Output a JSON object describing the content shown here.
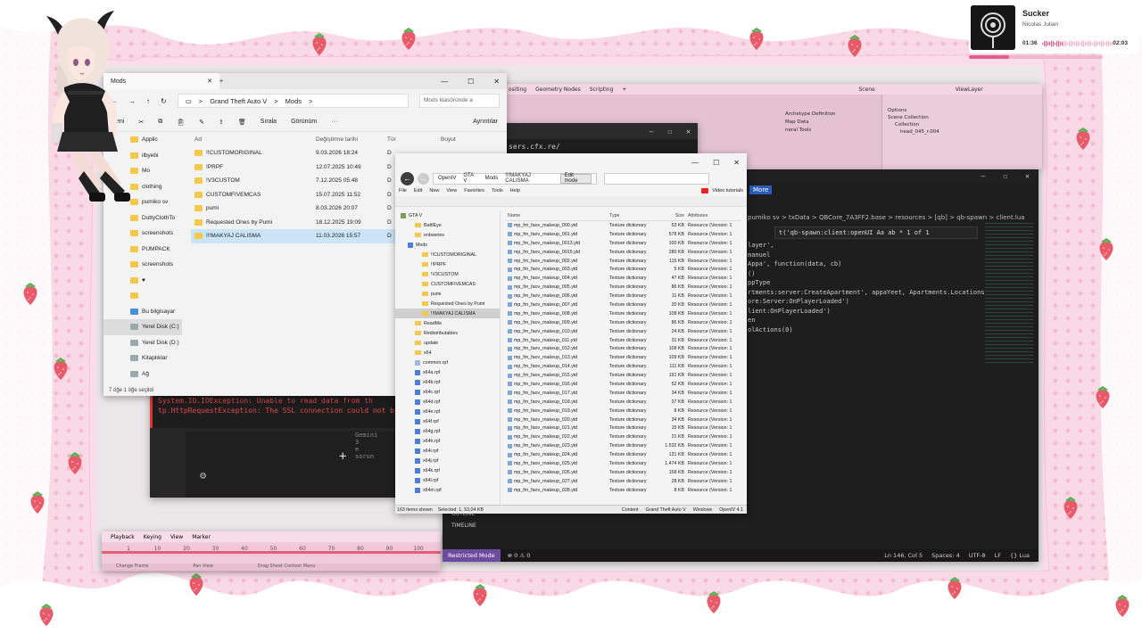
{
  "colors": {
    "pink_frame": "#f7c6d8",
    "strawberry": "#e85a6a",
    "selection": "#cce4f7",
    "vscode_bg": "#1e1e1e",
    "restricted": "#6b4ca1"
  },
  "music": {
    "title": "Sucker",
    "artist": "Nicolas Julian",
    "elapsed": "01:36",
    "duration": "02:03",
    "progress": 0.3
  },
  "blender": {
    "menu": [
      "ositing",
      "Geometry Nodes",
      "Scripting",
      "+"
    ],
    "scene": "Scene",
    "view_layer": "ViewLayer",
    "options": "Options",
    "scene_collection": "Scene Collection",
    "collection": "Collection",
    "object": "head_045_r.004",
    "rows": [
      "Archetype Definition",
      "Map Data",
      "neral Tools"
    ],
    "timeline_menu": [
      "Playback",
      "Keying",
      "View",
      "Marker"
    ],
    "timeline_ticks": [
      "1",
      "10",
      "20",
      "30",
      "40",
      "50",
      "60",
      "70",
      "80",
      "90",
      "100"
    ],
    "timeline_bottom": [
      "Change Frame",
      "Pan View",
      "Drag Sheet Context Menu"
    ]
  },
  "terminal": {
    "line": "sers.cfx.re/"
  },
  "dark_app": {
    "error1": "System.IO.IOException: Unable to read data from th",
    "error2": "tp.HttpRequestException: The SSL connection could not b",
    "prompt": "Gemini 3 e sorun"
  },
  "vscode": {
    "more": "More",
    "crumbs": "pumiko sv  >  txData  >  QBCore_7A3FF2.base  >  resources  >  [qb]  >  qb-spawn  >  client.lua",
    "find_text": "t('qb-spawn:client:openUI Aa  ab  *   1 of 1",
    "code": [
      "layer',",
      "manuel",
      "",
      "",
      "Appa', function(data, cb)",
      "()",
      "ppType",
      "",
      "",
      "",
      "rtments:server:CreateApartment', appaYeet, Apartments.Locations",
      "ore:Server:OnPlayerLoaded')",
      "lient:OnPlayerLoaded')",
      "",
      "",
      "",
      "",
      "",
      "",
      "",
      "",
      "en",
      "olActions(0)"
    ],
    "outline": "OUTLINE",
    "timeline": "TIMELINE",
    "restricted": "Restricted Mode",
    "problems": "⊗ 0  ⚠ 0",
    "ln_col": "Ln 146, Col 5",
    "spaces": "Spaces: 4",
    "encoding": "UTF-8",
    "eol": "LF",
    "lang": "{} Lua"
  },
  "explorer": {
    "tab_title": "Mods",
    "breadcrumb": [
      "Grand Theft Auto V",
      ">",
      "Mods",
      ">"
    ],
    "search_placeholder": "Mods klasöründe a",
    "cmd_new": "Yeni",
    "cmd_sort": "Sırala",
    "cmd_view": "Görünüm",
    "cmd_more": "···",
    "cmd_details": "Ayrıntılar",
    "nav": [
      "Applic",
      "ilbyebi",
      "Mo",
      "clothing",
      "pumiko sv",
      "DuttyClothTo",
      "screenshots",
      "PUMPACK",
      "screenshots",
      "♥",
      "",
      "Bu bilgisayar",
      "Yerel Disk (C:)",
      "Yerel Disk (D:)",
      "Kitaplıklar",
      "Ağ"
    ],
    "headers": [
      "Ad",
      "Değiştirme tarihi",
      "Tür",
      "Boyut"
    ],
    "files": [
      {
        "name": "!!CUSTOMORIGINAL",
        "date": "9.03.2026 18:24",
        "type": "D"
      },
      {
        "name": "!PRPF",
        "date": "12.07.2025 10:49",
        "type": "D"
      },
      {
        "name": "!V3CUSTOM",
        "date": "7.12.2025 05:48",
        "type": "D"
      },
      {
        "name": "CUSTOMFIVEMCAS",
        "date": "15.07.2025 11:52",
        "type": "D"
      },
      {
        "name": "pumi",
        "date": "8.03.2026 20:07",
        "type": "D"
      },
      {
        "name": "Requested Ones by Pumi",
        "date": "18.12.2025 19:09",
        "type": "D"
      },
      {
        "name": "!!!MAKYAJ CALISMA",
        "date": "11.03.2026 15:57",
        "type": "D"
      }
    ],
    "status": "7 öğe   1 öğe seçildi"
  },
  "openiv": {
    "path": [
      "OpenIV",
      "GTA V",
      "Mods",
      "!!!MAKYAJ CALISMA"
    ],
    "edit_mode": "Edit mode",
    "menu": [
      "File",
      "Edit",
      "New",
      "View",
      "Favorites",
      "Tools",
      "Help"
    ],
    "video_tutorials": "Video tutorials",
    "tree": [
      {
        "label": "GTA V",
        "kind": "gta"
      },
      {
        "label": "BattlEye",
        "kind": "folder"
      },
      {
        "label": "enbseries",
        "kind": "folder"
      },
      {
        "label": "Mods",
        "kind": "rpf"
      },
      {
        "label": "!!CUSTOMORIGINAL",
        "kind": "folder"
      },
      {
        "label": "!!PRPF",
        "kind": "folder"
      },
      {
        "label": "!V3CUSTOM",
        "kind": "folder"
      },
      {
        "label": "CUSTOMFIVEMCAS",
        "kind": "folder"
      },
      {
        "label": "pumi",
        "kind": "folder"
      },
      {
        "label": "Requested Ones by Pumi",
        "kind": "folder"
      },
      {
        "label": "!!!MAKYAJ CALISMA",
        "kind": "folder"
      },
      {
        "label": "ReadMe",
        "kind": "folder"
      },
      {
        "label": "Redistributables",
        "kind": "folder"
      },
      {
        "label": "update",
        "kind": "folder"
      },
      {
        "label": "x64",
        "kind": "folder"
      },
      {
        "label": "common.rpf",
        "kind": "disk"
      },
      {
        "label": "x64a.rpf",
        "kind": "rpf"
      },
      {
        "label": "x64b.rpf",
        "kind": "rpf"
      },
      {
        "label": "x64c.rpf",
        "kind": "rpf"
      },
      {
        "label": "x64d.rpf",
        "kind": "rpf"
      },
      {
        "label": "x64e.rpf",
        "kind": "rpf"
      },
      {
        "label": "x64f.rpf",
        "kind": "rpf"
      },
      {
        "label": "x64g.rpf",
        "kind": "rpf"
      },
      {
        "label": "x64h.rpf",
        "kind": "rpf"
      },
      {
        "label": "x64i.rpf",
        "kind": "rpf"
      },
      {
        "label": "x64j.rpf",
        "kind": "rpf"
      },
      {
        "label": "x64k.rpf",
        "kind": "rpf"
      },
      {
        "label": "x64l.rpf",
        "kind": "rpf"
      },
      {
        "label": "x64m.rpf",
        "kind": "rpf"
      }
    ],
    "headers": [
      "Name",
      "Type",
      "Size",
      "Attributes"
    ],
    "rows": [
      {
        "name": "mp_fm_faov_makeup_000.ytd",
        "size": "53 KB"
      },
      {
        "name": "mp_fm_faov_makeup_001.ytd",
        "size": "578 KB"
      },
      {
        "name": "mp_fm_faov_makeup_0013.ytd",
        "size": "100 KB"
      },
      {
        "name": "mp_fm_faov_makeup_0015.ytd",
        "size": "280 KB"
      },
      {
        "name": "mp_fm_faov_makeup_002.ytd",
        "size": "115 KB"
      },
      {
        "name": "mp_fm_faov_makeup_003.ytd",
        "size": "5 KB"
      },
      {
        "name": "mp_fm_faov_makeup_004.ytd",
        "size": "47 KB"
      },
      {
        "name": "mp_fm_faov_makeup_005.ytd",
        "size": "86 KB"
      },
      {
        "name": "mp_fm_faov_makeup_006.ytd",
        "size": "11 KB"
      },
      {
        "name": "mp_fm_faov_makeup_007.ytd",
        "size": "20 KB"
      },
      {
        "name": "mp_fm_faov_makeup_008.ytd",
        "size": "108 KB"
      },
      {
        "name": "mp_fm_faov_makeup_009.ytd",
        "size": "86 KB"
      },
      {
        "name": "mp_fm_faov_makeup_010.ytd",
        "size": "24 KB"
      },
      {
        "name": "mp_fm_faov_makeup_011.ytd",
        "size": "31 KB"
      },
      {
        "name": "mp_fm_faov_makeup_012.ytd",
        "size": "108 KB"
      },
      {
        "name": "mp_fm_faov_makeup_013.ytd",
        "size": "109 KB"
      },
      {
        "name": "mp_fm_faov_makeup_014.ytd",
        "size": "111 KB"
      },
      {
        "name": "mp_fm_faov_makeup_015.ytd",
        "size": "191 KB"
      },
      {
        "name": "mp_fm_faov_makeup_016.ytd",
        "size": "52 KB"
      },
      {
        "name": "mp_fm_faov_makeup_017.ytd",
        "size": "34 KB"
      },
      {
        "name": "mp_fm_faov_makeup_018.ytd",
        "size": "37 KB"
      },
      {
        "name": "mp_fm_faov_makeup_019.ytd",
        "size": "8 KB"
      },
      {
        "name": "mp_fm_faov_makeup_020.ytd",
        "size": "34 KB"
      },
      {
        "name": "mp_fm_faov_makeup_021.ytd",
        "size": "15 KB"
      },
      {
        "name": "mp_fm_faov_makeup_022.ytd",
        "size": "21 KB"
      },
      {
        "name": "mp_fm_faov_makeup_023.ytd",
        "size": "1.532 KB"
      },
      {
        "name": "mp_fm_faov_makeup_024.ytd",
        "size": "131 KB"
      },
      {
        "name": "mp_fm_faov_makeup_025.ytd",
        "size": "1.474 KB"
      },
      {
        "name": "mp_fm_faov_makeup_026.ytd",
        "size": "158 KB"
      },
      {
        "name": "mp_fm_faov_makeup_027.ytd",
        "size": "28 KB"
      },
      {
        "name": "mp_fm_faov_makeup_028.ytd",
        "size": "8 KB"
      }
    ],
    "row_type": "Texture dictionary",
    "row_attr": "Resource (Version: 1",
    "status_left": "163 items shown",
    "status_sel": "Selected: 1,  53,04 KB",
    "status_right": [
      "Content",
      "Grand Theft Auto V",
      "Windows",
      "OpenIV 4.1"
    ]
  }
}
